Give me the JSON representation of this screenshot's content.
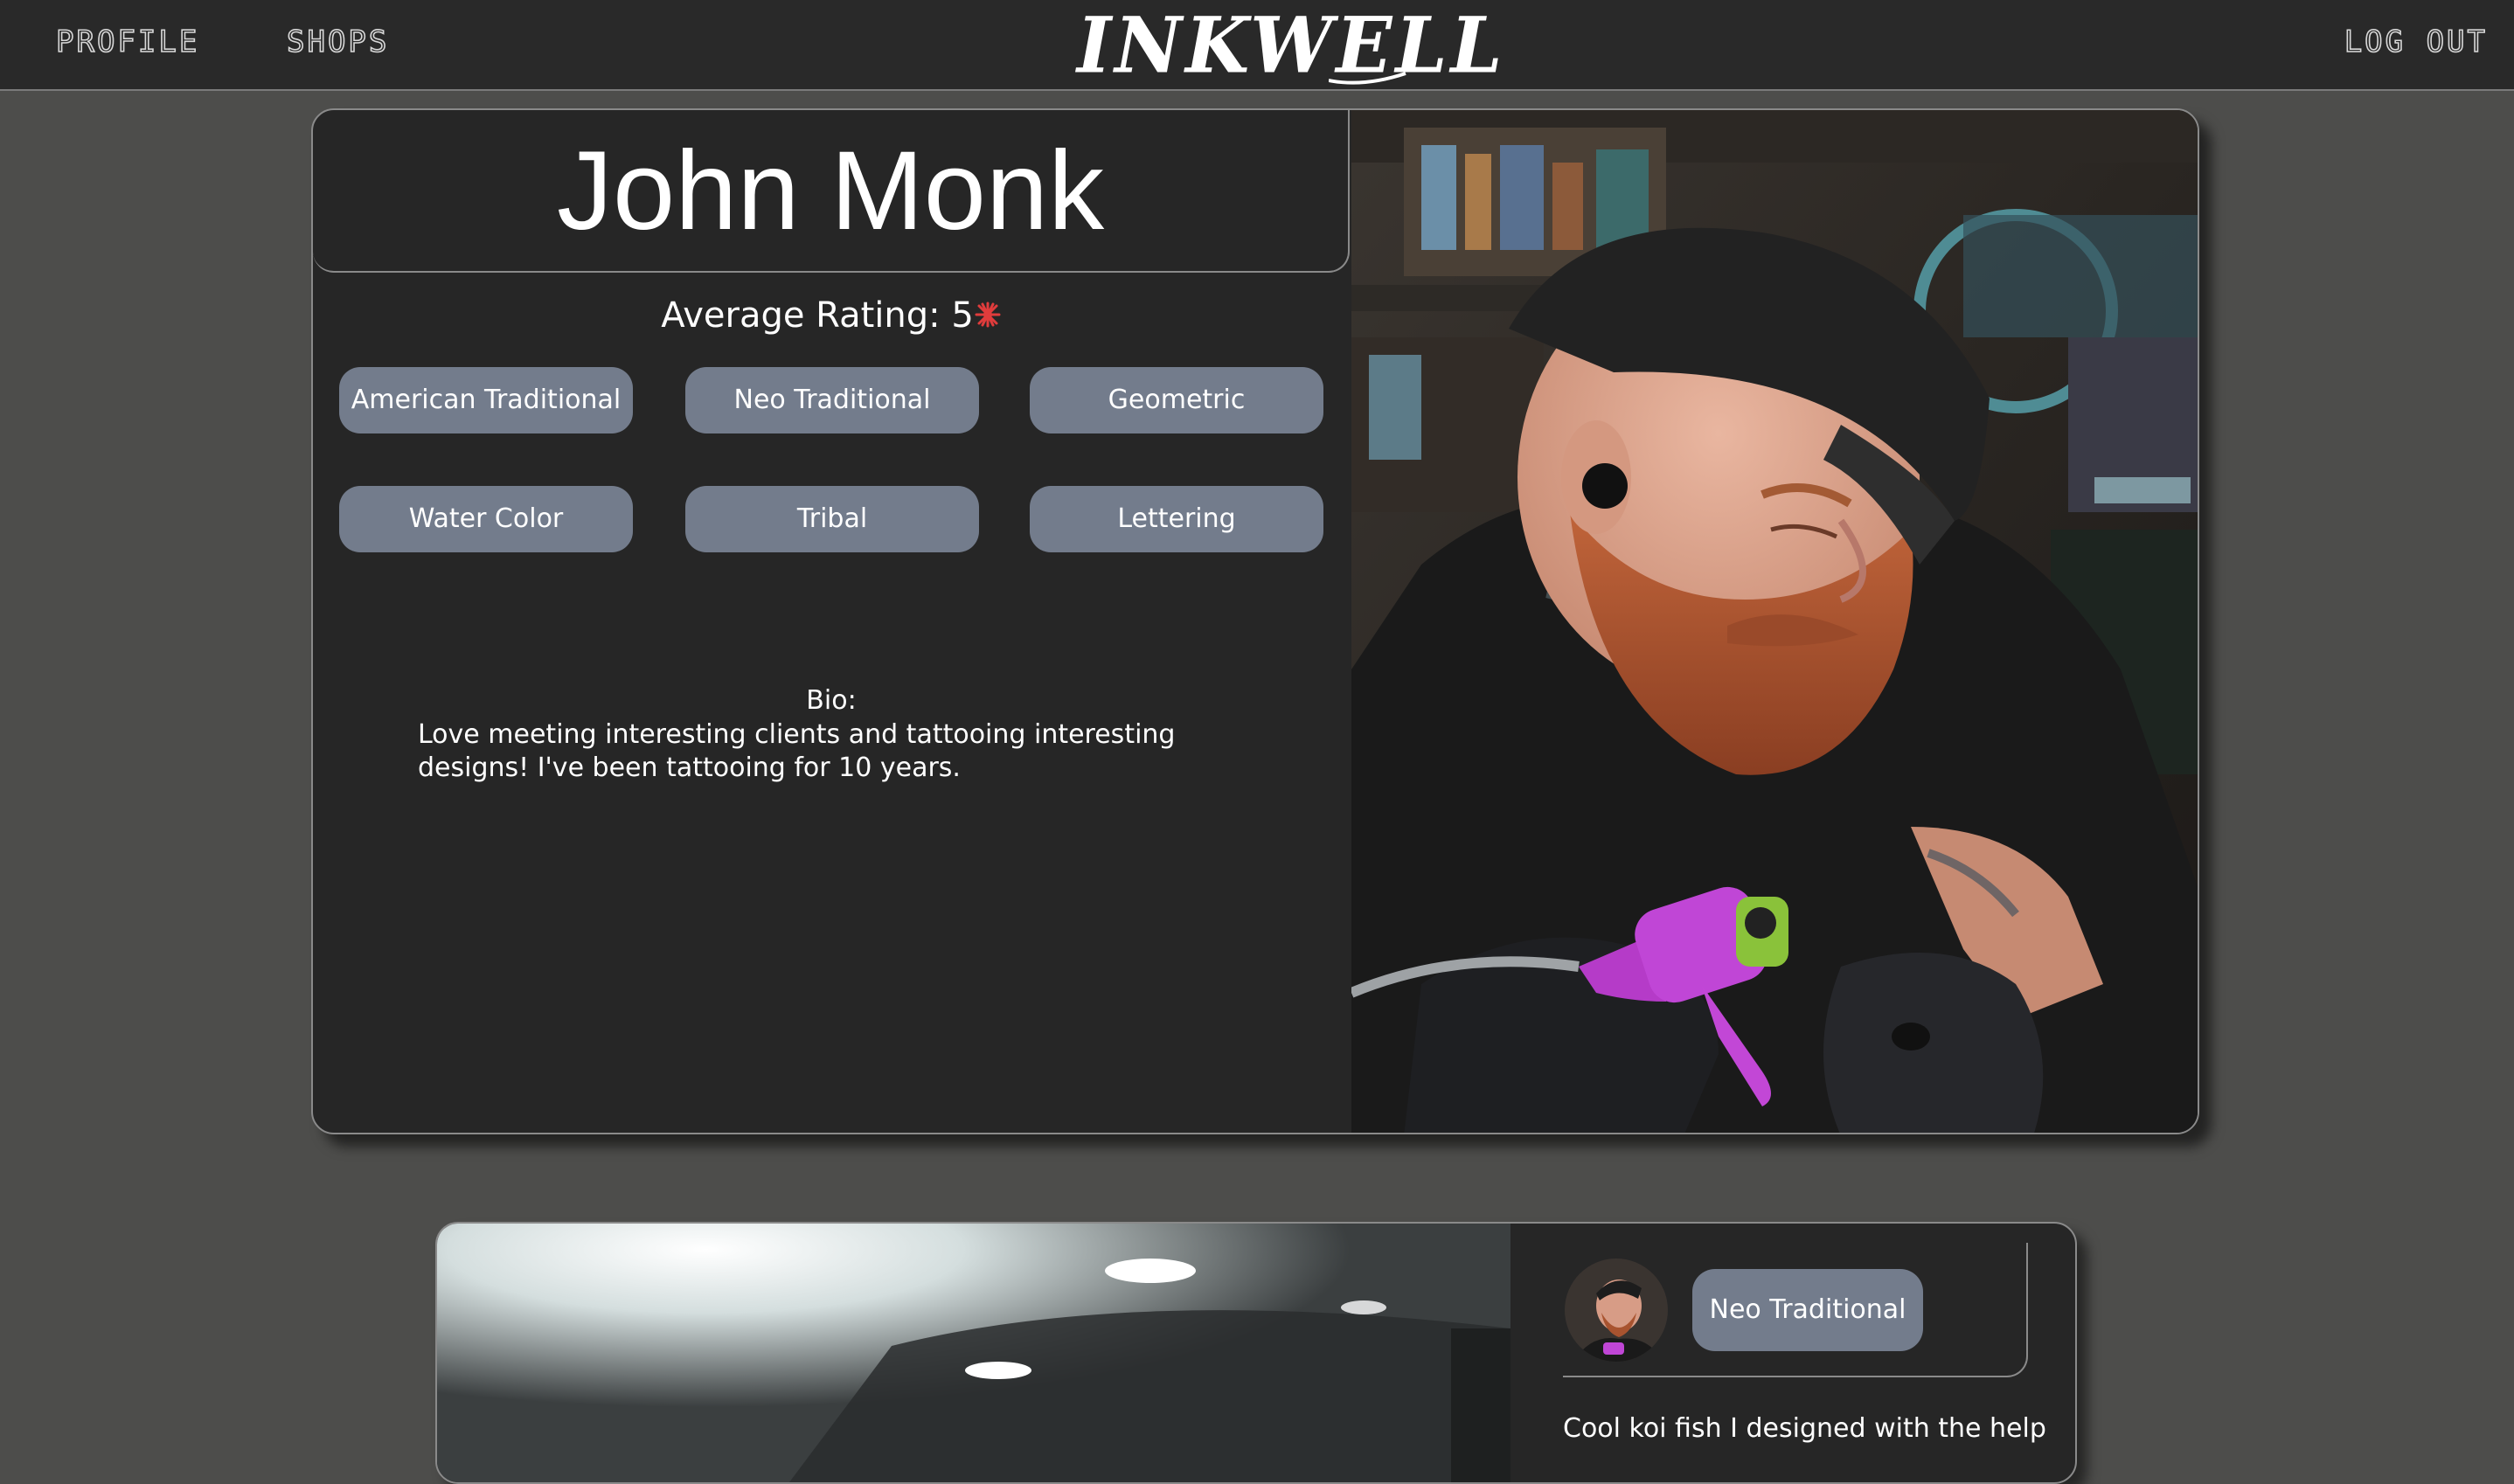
{
  "header": {
    "nav_profile": "PROFILE",
    "nav_shops": "SHOPS",
    "brand": "INKWELL",
    "nav_logout": "LOG OUT"
  },
  "profile": {
    "name": "John Monk",
    "rating_label": "Average Rating: 5",
    "star_icon": "red-star-icon",
    "styles": [
      "American Traditional",
      "Neo Traditional",
      "Geometric",
      "Water Color",
      "Tribal",
      "Lettering"
    ],
    "bio_label": "Bio:",
    "bio_text": "Love meeting interesting clients and tattooing interesting designs! I've been tattooing for 10 years."
  },
  "post": {
    "style_tag": "Neo Traditional",
    "caption": "Cool koi fish I designed with the help"
  },
  "colors": {
    "page_bg": "#4d4d4b",
    "header_bg": "#292929",
    "card_bg": "#262626",
    "tag_bg": "#737c8c",
    "star": "#e03c3c"
  }
}
